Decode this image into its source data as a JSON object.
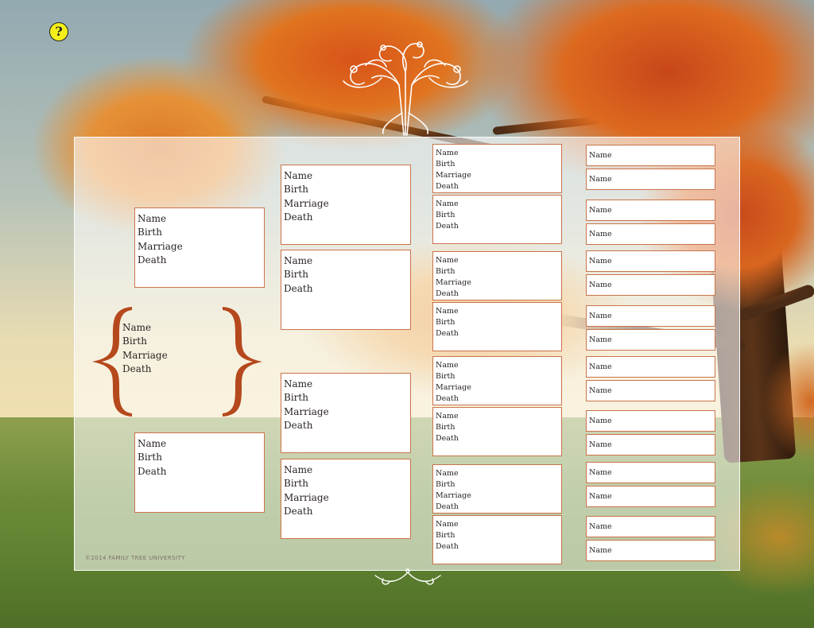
{
  "help_button": {
    "label": "?"
  },
  "copyright": "©2014 FAMILY TREE UNIVERSITY",
  "colors": {
    "box_border": "#c9744a",
    "brace": "#b5481c",
    "help": "#f3ef1b"
  },
  "labels": {
    "name": "Name",
    "birth": "Birth",
    "marriage": "Marriage",
    "death": "Death"
  },
  "chart": {
    "root": {
      "lines": [
        "Name",
        "Birth",
        "Marriage",
        "Death"
      ]
    },
    "parents": [
      {
        "lines": [
          "Name",
          "Birth",
          "Marriage",
          "Death"
        ]
      },
      {
        "lines": [
          "Name",
          "Birth",
          "Death"
        ]
      }
    ],
    "grandparents": [
      {
        "lines": [
          "Name",
          "Birth",
          "Marriage",
          "Death"
        ]
      },
      {
        "lines": [
          "Name",
          "Birth",
          "Death"
        ]
      },
      {
        "lines": [
          "Name",
          "Birth",
          "Marriage",
          "Death"
        ]
      },
      {
        "lines": [
          "Name",
          "Birth",
          "Marriage",
          "Death"
        ]
      }
    ],
    "great_grandparents": [
      {
        "lines": [
          "Name",
          "Birth",
          "Marriage",
          "Death"
        ]
      },
      {
        "lines": [
          "Name",
          "Birth",
          "Death"
        ]
      },
      {
        "lines": [
          "Name",
          "Birth",
          "Marriage",
          "Death"
        ]
      },
      {
        "lines": [
          "Name",
          "Birth",
          "Death"
        ]
      },
      {
        "lines": [
          "Name",
          "Birth",
          "Marriage",
          "Death"
        ]
      },
      {
        "lines": [
          "Name",
          "Birth",
          "Death"
        ]
      },
      {
        "lines": [
          "Name",
          "Birth",
          "Marriage",
          "Death"
        ]
      },
      {
        "lines": [
          "Name",
          "Birth",
          "Death"
        ]
      }
    ],
    "gg_grandparents": [
      "Name",
      "Name",
      "Name",
      "Name",
      "Name",
      "Name",
      "Name",
      "Name",
      "Name",
      "Name",
      "Name",
      "Name",
      "Name",
      "Name",
      "Name",
      "Name"
    ]
  }
}
